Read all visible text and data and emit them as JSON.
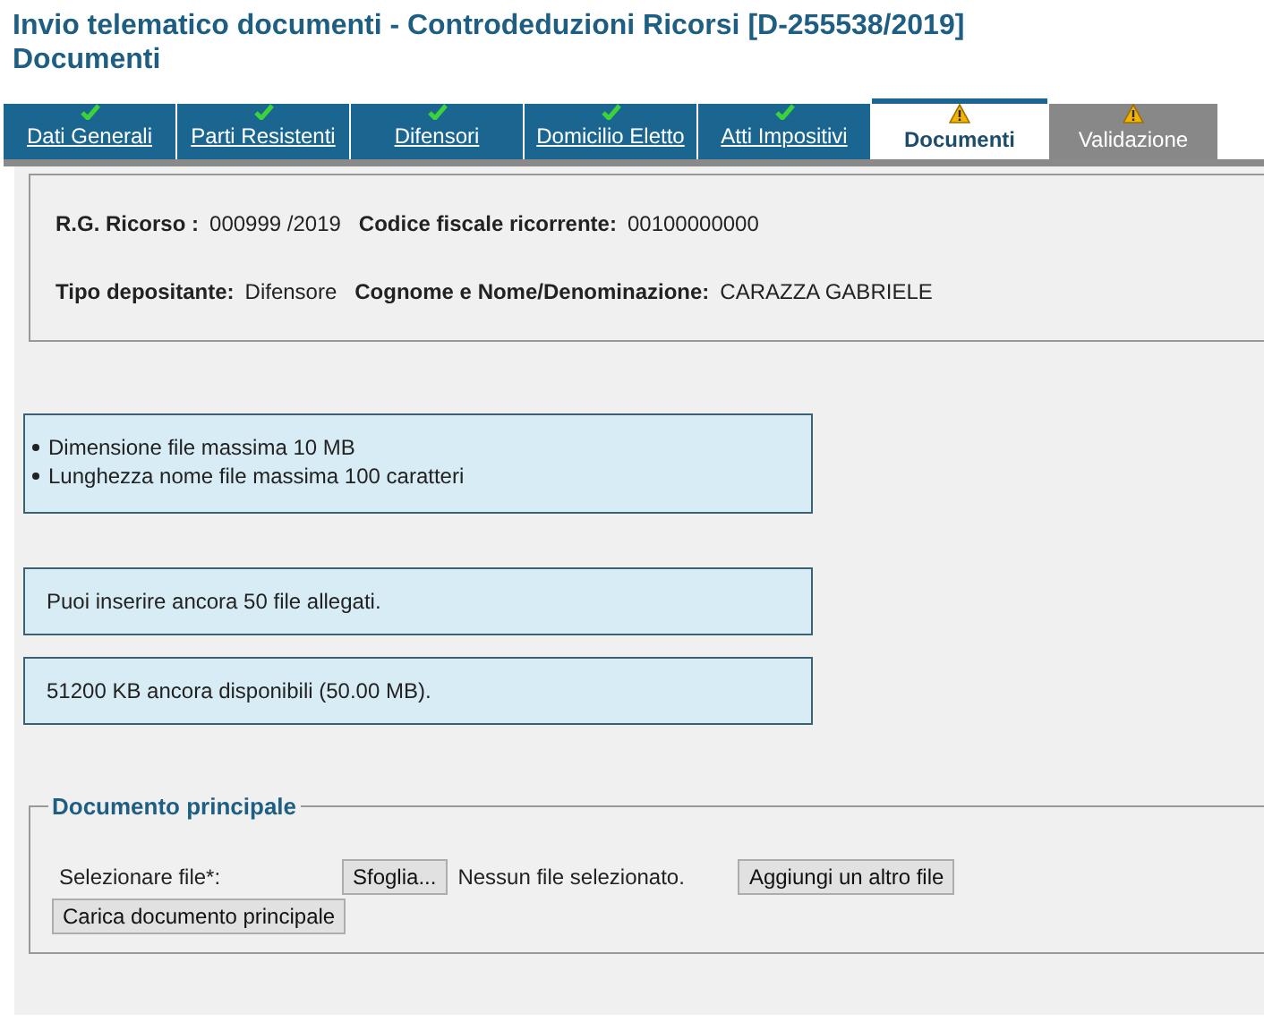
{
  "title": {
    "line1": "Invio telematico documenti - Controdeduzioni Ricorsi [D-255538/2019]",
    "line2": "Documenti"
  },
  "tabs": [
    {
      "label": "Dati Generali",
      "kind": "ok",
      "selected": false,
      "disabled": false
    },
    {
      "label": "Parti Resistenti",
      "kind": "ok",
      "selected": false,
      "disabled": false
    },
    {
      "label": "Difensori",
      "kind": "ok",
      "selected": false,
      "disabled": false
    },
    {
      "label": "Domicilio Eletto",
      "kind": "ok",
      "selected": false,
      "disabled": false
    },
    {
      "label": "Atti Impositivi",
      "kind": "ok",
      "selected": false,
      "disabled": false
    },
    {
      "label": "Documenti",
      "kind": "warning",
      "selected": true,
      "disabled": false
    },
    {
      "label": "Validazione",
      "kind": "warning",
      "selected": false,
      "disabled": true
    }
  ],
  "info": [
    [
      {
        "label": "R.G. Ricorso :",
        "value": "000999 /2019"
      },
      {
        "label": "Codice fiscale ricorrente:",
        "value": "00100000000"
      }
    ],
    [
      {
        "label": "Tipo depositante:",
        "value": "Difensore"
      },
      {
        "label": "Cognome e Nome/Denominazione:",
        "value": "CARAZZA GABRIELE"
      }
    ]
  ],
  "limits": [
    "Dimensione file massima 10 MB",
    "Lunghezza nome file massima 100 caratteri"
  ],
  "notices": [
    "Puoi inserire ancora 50 file allegati.",
    "51200 KB ancora disponibili (50.00 MB)."
  ],
  "main_document": {
    "legend": "Documento principale",
    "field_label": "Selezionare file*:",
    "browse_button": "Sfoglia...",
    "file_status": "Nessun file selezionato.",
    "add_button": "Aggiungi un altro file",
    "upload_button": "Carica documento principale"
  }
}
